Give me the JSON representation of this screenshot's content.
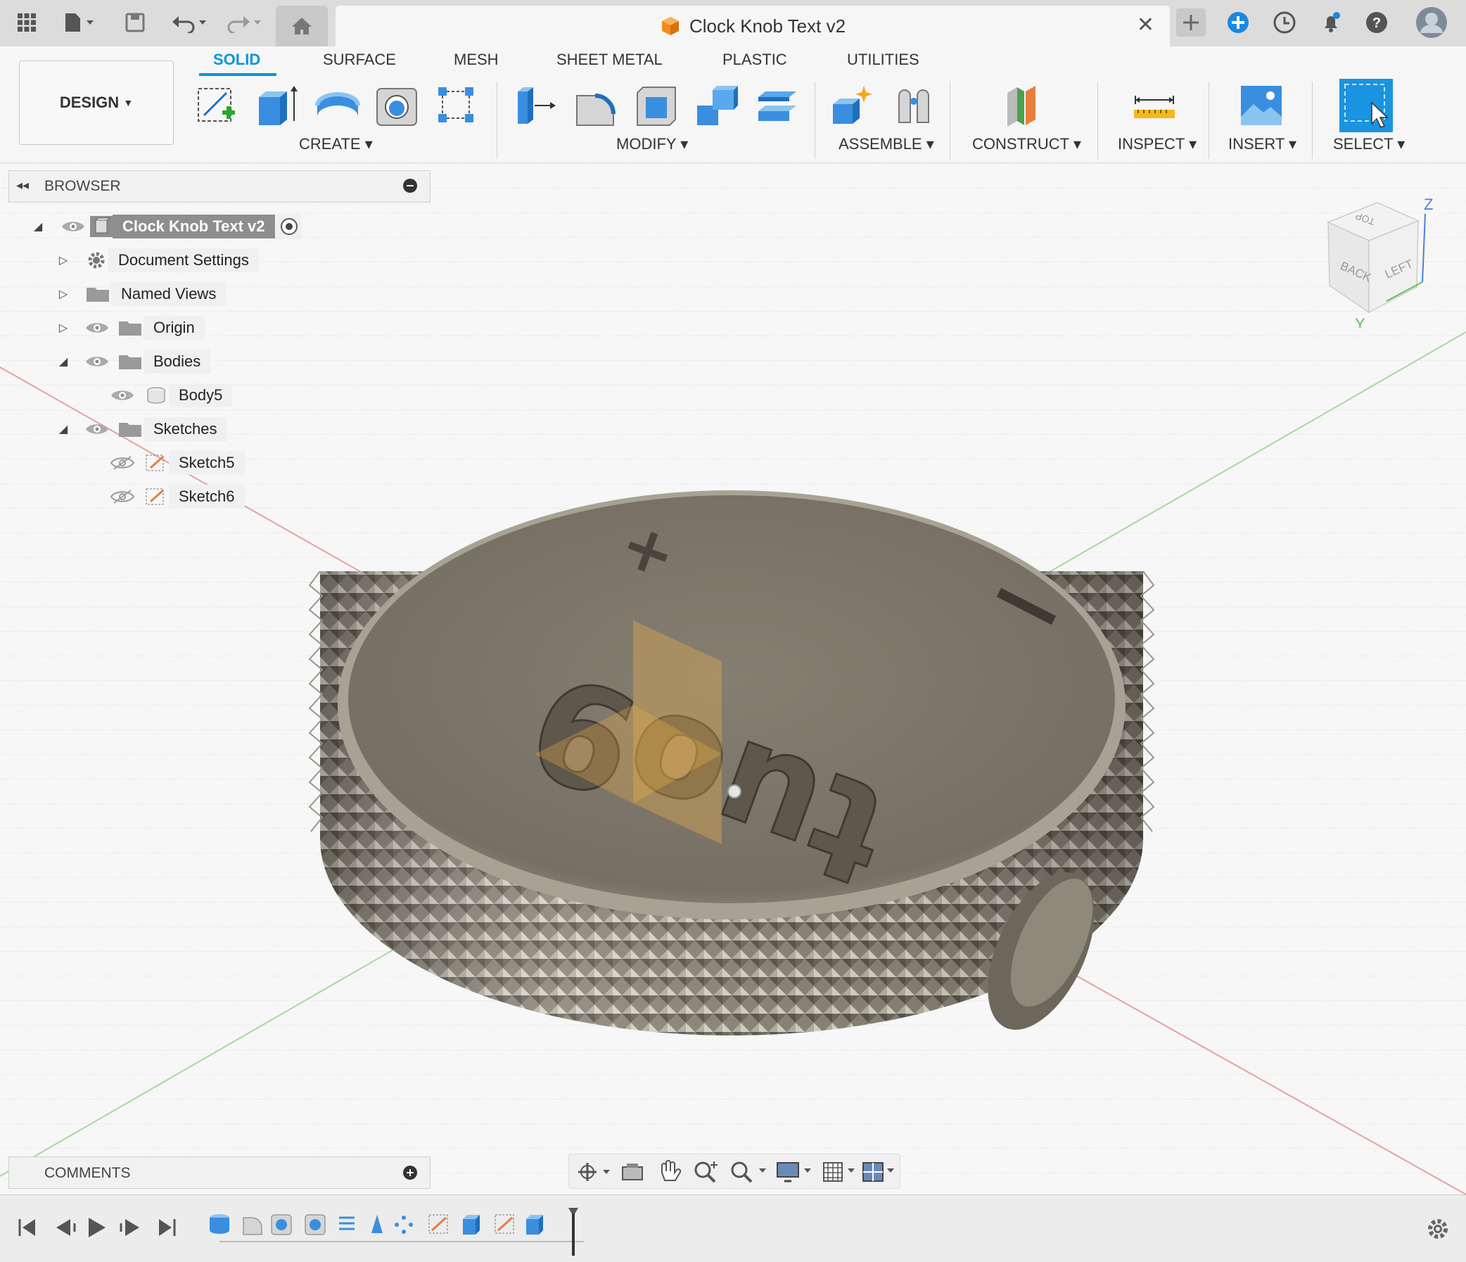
{
  "topbar": {
    "document_title": "Clock Knob Text v2",
    "icons": [
      "apps-grid-icon",
      "file-icon",
      "save-icon",
      "undo-icon",
      "redo-icon",
      "home-icon",
      "close-icon",
      "new-tab-icon",
      "extensions-icon",
      "job-status-icon",
      "notifications-icon",
      "help-icon",
      "user-avatar-icon"
    ]
  },
  "ribbon": {
    "workspace_label": "DESIGN",
    "tabs": [
      {
        "label": "SOLID"
      },
      {
        "label": "SURFACE"
      },
      {
        "label": "MESH"
      },
      {
        "label": "SHEET METAL"
      },
      {
        "label": "PLASTIC"
      },
      {
        "label": "UTILITIES"
      }
    ],
    "groups": [
      {
        "label": "CREATE"
      },
      {
        "label": "MODIFY"
      },
      {
        "label": "ASSEMBLE"
      },
      {
        "label": "CONSTRUCT"
      },
      {
        "label": "INSPECT"
      },
      {
        "label": "INSERT"
      },
      {
        "label": "SELECT"
      }
    ]
  },
  "browser": {
    "title": "BROWSER",
    "items": [
      {
        "label": "Clock Knob Text v2"
      },
      {
        "label": "Document Settings"
      },
      {
        "label": "Named Views"
      },
      {
        "label": "Origin"
      },
      {
        "label": "Bodies"
      },
      {
        "label": "Body5"
      },
      {
        "label": "Sketches"
      },
      {
        "label": "Sketch5"
      },
      {
        "label": "Sketch6"
      }
    ]
  },
  "viewcube": {
    "top": "TOP",
    "back": "BACK",
    "left": "LEFT",
    "axis_z": "Z",
    "axis_y": "Y"
  },
  "model": {
    "engraved_text": "tuo9",
    "plus_sign": "+",
    "minus_sign": "−"
  },
  "comments": {
    "title": "COMMENTS"
  },
  "colors": {
    "accent": "#0696d7",
    "ribbon_bg": "#f6f6f6",
    "topbar_bg": "#dcdcdc",
    "model_face": "#7b7568"
  }
}
